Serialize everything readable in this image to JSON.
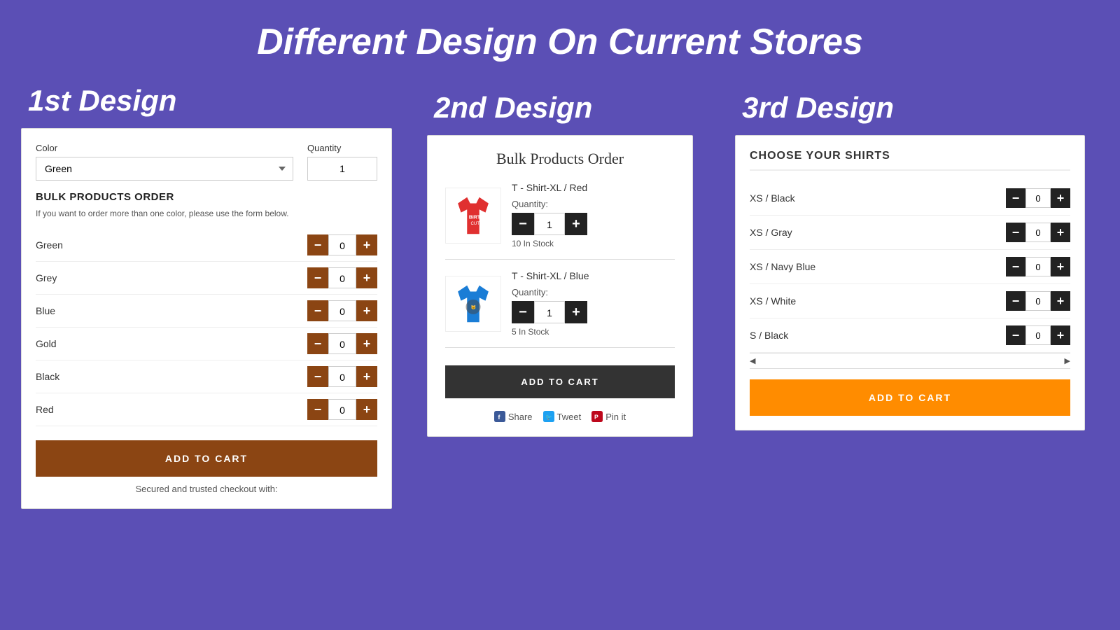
{
  "page": {
    "title": "Different Design On Current Stores",
    "background_color": "#5b4fb5"
  },
  "design1": {
    "label": "1st Design",
    "color_label": "Color",
    "color_value": "Green",
    "color_options": [
      "Green",
      "Grey",
      "Blue",
      "Gold",
      "Black",
      "Red"
    ],
    "quantity_label": "Quantity",
    "quantity_value": "1",
    "bulk_title": "BULK PRODUCTS ORDER",
    "bulk_subtitle": "If you want to order more than one color, please use the form below.",
    "rows": [
      {
        "label": "Green",
        "qty": "0"
      },
      {
        "label": "Grey",
        "qty": "0"
      },
      {
        "label": "Blue",
        "qty": "0"
      },
      {
        "label": "Gold",
        "qty": "0"
      },
      {
        "label": "Black",
        "qty": "0"
      },
      {
        "label": "Red",
        "qty": "0"
      }
    ],
    "add_to_cart": "ADD TO CART",
    "secured_text": "Secured and trusted checkout with:"
  },
  "design2": {
    "label": "2nd Design",
    "title": "Bulk Products Order",
    "products": [
      {
        "name": "T - Shirt-XL / Red",
        "qty_label": "Quantity:",
        "qty_value": "1",
        "stock": "10 In Stock",
        "color": "red"
      },
      {
        "name": "T - Shirt-XL / Blue",
        "qty_label": "Quantity:",
        "qty_value": "1",
        "stock": "5 In Stock",
        "color": "blue"
      }
    ],
    "add_to_cart": "ADD TO CART",
    "social": {
      "share": "Share",
      "tweet": "Tweet",
      "pin": "Pin it"
    }
  },
  "design3": {
    "label": "3rd Design",
    "choose_title": "CHOOSE YOUR SHIRTS",
    "rows": [
      {
        "label": "XS / Black",
        "qty": "0"
      },
      {
        "label": "XS / Gray",
        "qty": "0"
      },
      {
        "label": "XS / Navy Blue",
        "qty": "0"
      },
      {
        "label": "XS / White",
        "qty": "0"
      },
      {
        "label": "S / Black",
        "qty": "0"
      }
    ],
    "add_to_cart": "ADD TO CART"
  }
}
